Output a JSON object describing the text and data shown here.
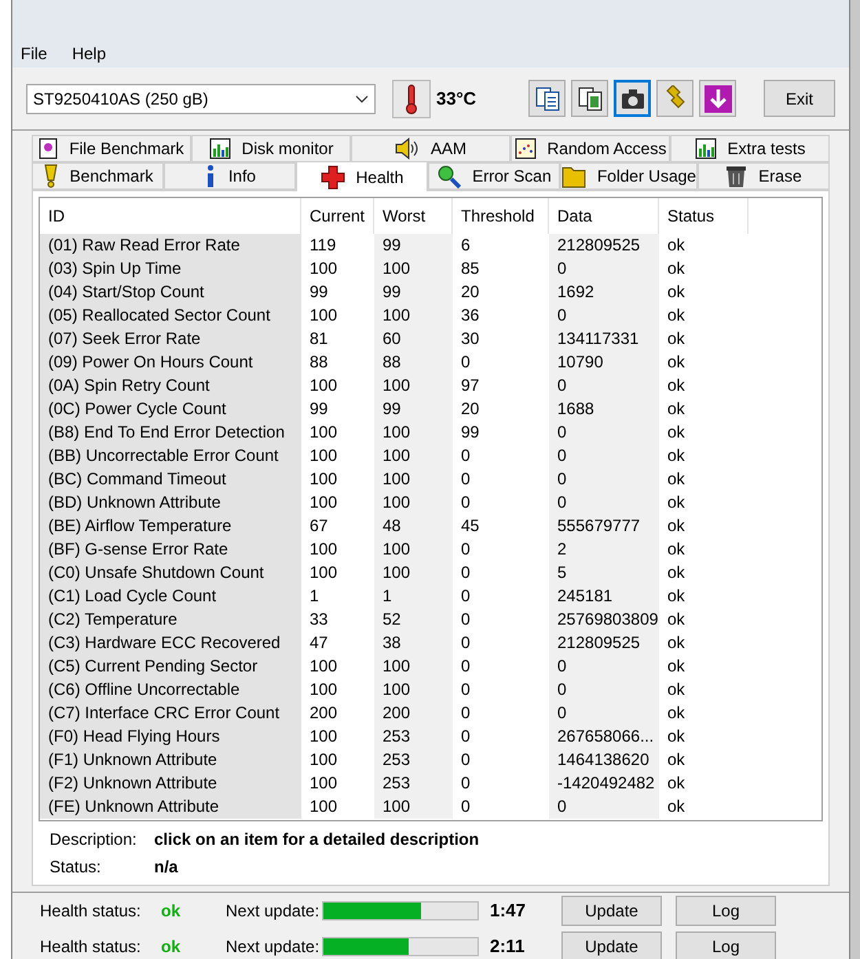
{
  "menu": [
    "File",
    "Help"
  ],
  "drive_select": {
    "value": "ST9250410AS (250 gB)"
  },
  "temperature": "33°C",
  "toolbar": [
    {
      "kind": "copy",
      "selected": false
    },
    {
      "kind": "copy2",
      "selected": false
    },
    {
      "kind": "camera",
      "selected": true
    },
    {
      "kind": "wrench",
      "selected": false
    },
    {
      "kind": "download",
      "selected": false
    }
  ],
  "exit_button": "Exit",
  "tabs_back": [
    {
      "label": "File Benchmark",
      "selected": false
    },
    {
      "label": "Disk monitor",
      "selected": false
    },
    {
      "label": "AAM",
      "selected": false
    },
    {
      "label": "Random Access",
      "selected": false
    },
    {
      "label": "Extra tests",
      "selected": false
    }
  ],
  "tabs_front": [
    {
      "label": "Benchmark",
      "selected": false
    },
    {
      "label": "Info",
      "selected": false
    },
    {
      "label": "Health",
      "selected": true
    },
    {
      "label": "Error Scan",
      "selected": false
    },
    {
      "label": "Folder Usage",
      "selected": false
    },
    {
      "label": "Erase",
      "selected": false
    }
  ],
  "table": {
    "columns": [
      "ID",
      "Current",
      "Worst",
      "Threshold",
      "Data",
      "Status"
    ],
    "rows": [
      [
        "(01) Raw Read Error Rate",
        "119",
        "99",
        "6",
        "212809525",
        "ok"
      ],
      [
        "(03) Spin Up Time",
        "100",
        "100",
        "85",
        "0",
        "ok"
      ],
      [
        "(04) Start/Stop Count",
        "99",
        "99",
        "20",
        "1692",
        "ok"
      ],
      [
        "(05) Reallocated Sector Count",
        "100",
        "100",
        "36",
        "0",
        "ok"
      ],
      [
        "(07) Seek Error Rate",
        "81",
        "60",
        "30",
        "134117331",
        "ok"
      ],
      [
        "(09) Power On Hours Count",
        "88",
        "88",
        "0",
        "10790",
        "ok"
      ],
      [
        "(0A) Spin Retry Count",
        "100",
        "100",
        "97",
        "0",
        "ok"
      ],
      [
        "(0C) Power Cycle Count",
        "99",
        "99",
        "20",
        "1688",
        "ok"
      ],
      [
        "(B8) End To End Error Detection",
        "100",
        "100",
        "99",
        "0",
        "ok"
      ],
      [
        "(BB) Uncorrectable Error Count",
        "100",
        "100",
        "0",
        "0",
        "ok"
      ],
      [
        "(BC) Command Timeout",
        "100",
        "100",
        "0",
        "0",
        "ok"
      ],
      [
        "(BD) Unknown Attribute",
        "100",
        "100",
        "0",
        "0",
        "ok"
      ],
      [
        "(BE) Airflow Temperature",
        "67",
        "48",
        "45",
        "555679777",
        "ok"
      ],
      [
        "(BF) G-sense Error Rate",
        "100",
        "100",
        "0",
        "2",
        "ok"
      ],
      [
        "(C0) Unsafe Shutdown Count",
        "100",
        "100",
        "0",
        "5",
        "ok"
      ],
      [
        "(C1) Load Cycle Count",
        "1",
        "1",
        "0",
        "245181",
        "ok"
      ],
      [
        "(C2) Temperature",
        "33",
        "52",
        "0",
        "25769803809",
        "ok"
      ],
      [
        "(C3) Hardware ECC Recovered",
        "47",
        "38",
        "0",
        "212809525",
        "ok"
      ],
      [
        "(C5) Current Pending Sector",
        "100",
        "100",
        "0",
        "0",
        "ok"
      ],
      [
        "(C6) Offline Uncorrectable",
        "100",
        "100",
        "0",
        "0",
        "ok"
      ],
      [
        "(C7) Interface CRC Error Count",
        "200",
        "200",
        "0",
        "0",
        "ok"
      ],
      [
        "(F0) Head Flying Hours",
        "100",
        "253",
        "0",
        "267658066...",
        "ok"
      ],
      [
        "(F1) Unknown Attribute",
        "100",
        "253",
        "0",
        "1464138620",
        "ok"
      ],
      [
        "(F2) Unknown Attribute",
        "100",
        "253",
        "0",
        "-1420492482",
        "ok"
      ],
      [
        "(FE) Unknown Attribute",
        "100",
        "100",
        "0",
        "0",
        "ok"
      ]
    ]
  },
  "description": {
    "label": "Description:",
    "value": "click on an item for a detailed description"
  },
  "status": {
    "label": "Status:",
    "value": "n/a"
  },
  "health_rows": [
    {
      "label": "Health status:",
      "value": "ok",
      "next_label": "Next update:",
      "level": 0.63,
      "time": "1:47",
      "update_button": "Update",
      "log_button": "Log"
    },
    {
      "label": "Health status:",
      "value": "ok",
      "next_label": "Next update:",
      "level": 0.55,
      "time": "2:11",
      "update_button": "Update",
      "log_button": "Log"
    }
  ]
}
